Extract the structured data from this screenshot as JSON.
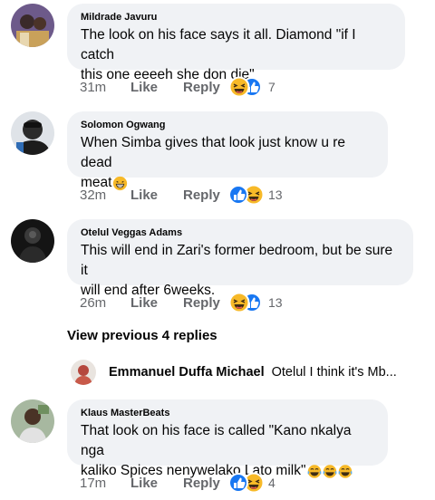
{
  "comments": [
    {
      "author": "Mildrade Javuru",
      "text_line1": "The look on his face says it all. Diamond \"if I catch",
      "text_line2": "this one eeeeh she don die\"",
      "time": "31m",
      "like": "Like",
      "reply": "Reply",
      "reactions": [
        "haha",
        "like"
      ],
      "reaction_count": "7"
    },
    {
      "author": "Solomon Ogwang",
      "text_line1": "When Simba gives that look just know u re dead",
      "text_line2": "meat",
      "time": "32m",
      "like": "Like",
      "reply": "Reply",
      "reactions": [
        "like",
        "haha"
      ],
      "reaction_count": "13"
    },
    {
      "author": "Otelul Veggas Adams",
      "text_line1": "This will end in Zari's former bedroom, but be sure it",
      "text_line2": "will end after 6weeks.",
      "time": "26m",
      "like": "Like",
      "reply": "Reply",
      "reactions": [
        "haha",
        "like"
      ],
      "reaction_count": "13"
    },
    {
      "author": "Klaus MasterBeats",
      "text_line1": "That look on his face is called \"Kano nkalya nga",
      "text_line2": "kaliko Spices nenywelako Lato milk\"",
      "time": "17m",
      "like": "Like",
      "reply": "Reply",
      "reactions": [
        "like",
        "haha"
      ],
      "reaction_count": "4"
    }
  ],
  "view_previous": "View previous 4 replies",
  "nested_reply": {
    "author": "Emmanuel Duffa Michael",
    "text": "Otelul I think it's Mb..."
  },
  "colors": {
    "bubble": "#f0f2f5",
    "meta_text": "#65676b",
    "like_blue": "#1877f2",
    "haha_yellow": "#f7b928"
  }
}
